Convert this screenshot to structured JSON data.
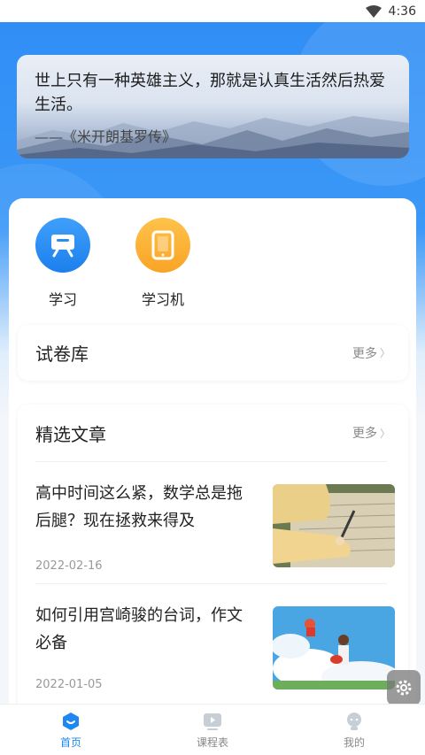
{
  "status_bar": {
    "time": "4:36"
  },
  "quote": {
    "text": "世上只有一种英雄主义，那就是认真生活然后热爱生活。",
    "source": "——《米开朗基罗传》"
  },
  "apps": [
    {
      "label": "学习",
      "icon": "tv-robot-icon"
    },
    {
      "label": "学习机",
      "icon": "tablet-icon"
    }
  ],
  "exam_library": {
    "title": "试卷库",
    "more": "更多"
  },
  "featured": {
    "title": "精选文章",
    "more": "更多",
    "articles": [
      {
        "title": "高中时间这么紧，数学总是拖后腿？现在拯救来得及",
        "date": "2022-02-16"
      },
      {
        "title": "如何引用宫崎骏的台词，作文必备",
        "date": "2022-01-05"
      }
    ]
  },
  "bottom_nav": [
    {
      "label": "首页",
      "active": true
    },
    {
      "label": "课程表",
      "active": false
    },
    {
      "label": "我的",
      "active": false
    }
  ],
  "colors": {
    "primary": "#1e88f0",
    "orange": "#f9a426"
  }
}
